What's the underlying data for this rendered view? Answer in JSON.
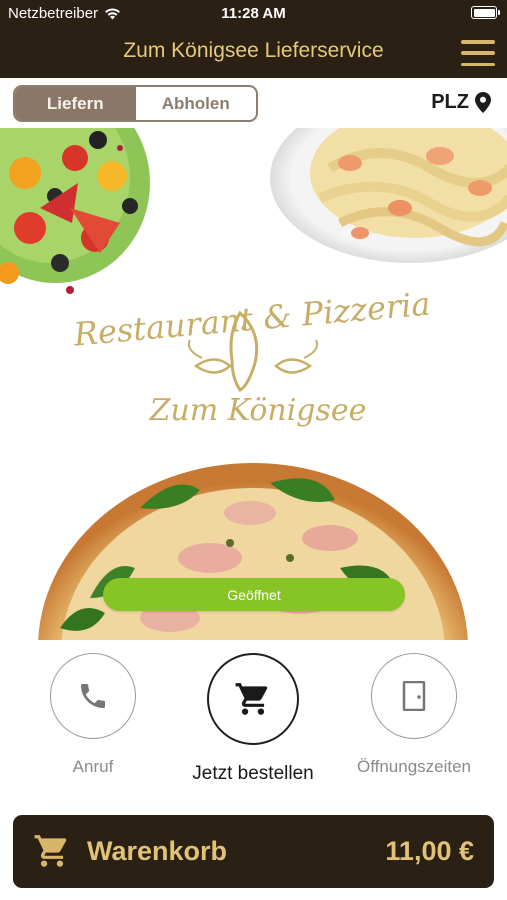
{
  "status_bar": {
    "carrier": "Netzbetreiber",
    "time": "11:28 AM"
  },
  "header": {
    "title": "Zum Königsee Lieferservice",
    "menu_icon": "hamburger-menu-icon"
  },
  "order_mode": {
    "options": [
      "Liefern",
      "Abholen"
    ],
    "selected": "Liefern"
  },
  "plz": {
    "label": "PLZ",
    "icon": "location-pin-icon"
  },
  "logo": {
    "line1": "Restaurant & Pizzeria",
    "line2": "Zum Königsee"
  },
  "status": {
    "label": "Geöffnet",
    "color": "#86c525"
  },
  "actions": [
    {
      "label": "Anruf",
      "icon": "phone-icon"
    },
    {
      "label": "Jetzt bestellen",
      "icon": "shopping-cart-icon"
    },
    {
      "label": "Öffnungszeiten",
      "icon": "door-icon"
    }
  ],
  "cart": {
    "label": "Warenkorb",
    "total": "11,00 €",
    "icon": "shopping-cart-icon"
  },
  "colors": {
    "brand_dark": "#2b2014",
    "gold": "#d7b66a",
    "toggle_active": "#8a7768"
  }
}
